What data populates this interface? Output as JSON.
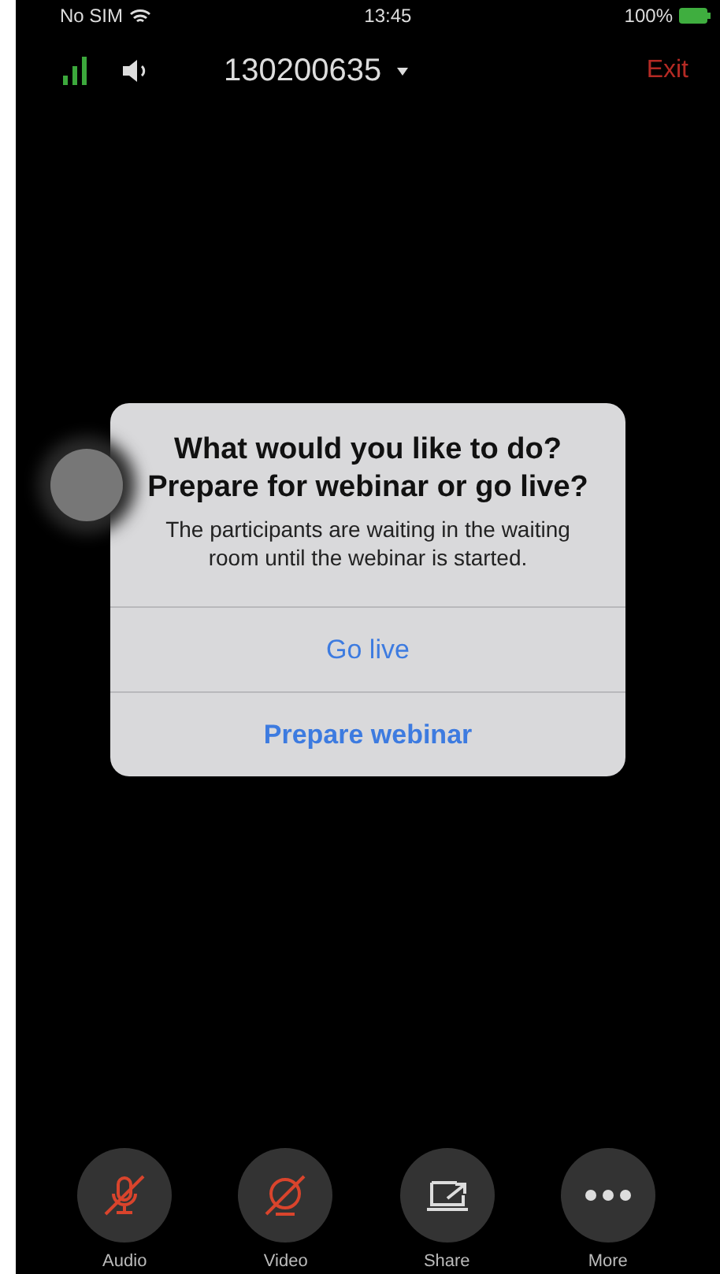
{
  "status_bar": {
    "carrier": "No SIM",
    "time": "13:45",
    "battery": "100%"
  },
  "top_bar": {
    "meeting_id": "130200635",
    "exit": "Exit"
  },
  "dialog": {
    "title": "What would you like to do? Prepare for webinar or go live?",
    "message": "The participants are waiting in the waiting room until the webinar is started.",
    "actions": [
      {
        "label": "Go live",
        "kind": "normal"
      },
      {
        "label": "Prepare webinar",
        "kind": "bold"
      }
    ]
  },
  "toolbar": [
    {
      "label": "Audio",
      "kind": "audio",
      "off": true
    },
    {
      "label": "Video",
      "kind": "video",
      "off": true
    },
    {
      "label": "Share",
      "kind": "share",
      "off": false
    },
    {
      "label": "More",
      "kind": "more",
      "off": false
    }
  ]
}
